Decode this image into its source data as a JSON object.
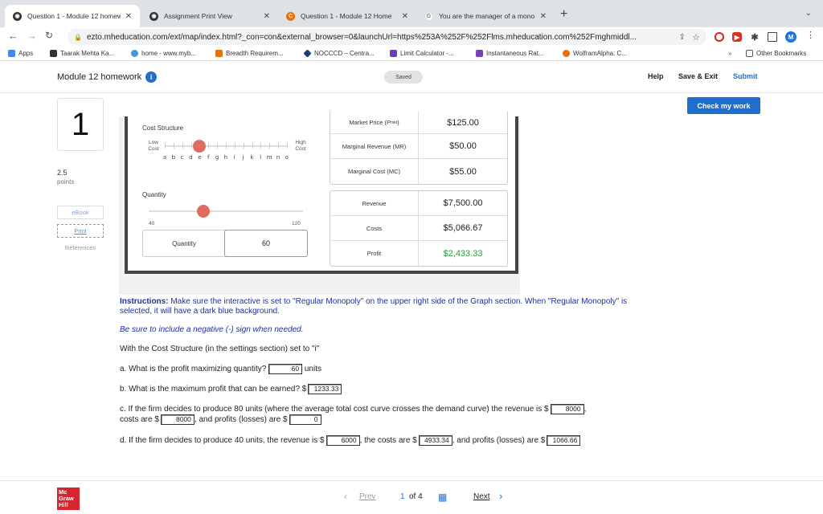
{
  "browser": {
    "tabs": [
      {
        "label": "Question 1 - Module 12 homew",
        "active": true
      },
      {
        "label": "Assignment Print View",
        "active": false
      },
      {
        "label": "Question 1 - Module 12 Home",
        "active": false
      },
      {
        "label": "You are the manager of a mono",
        "active": false
      }
    ],
    "url": "ezto.mheducation.com/ext/map/index.html?_con=con&external_browser=0&launchUrl=https%253A%252F%252Flms.mheducation.com%252Fmghmiddl...",
    "bookmarks": [
      "Apps",
      "Taarak Mehta Ka...",
      "home - www.myb...",
      "Breadth Requirem...",
      "NOCCCD – Centra...",
      "Limit Calculator -...",
      "Instantaneous Rat...",
      "WolframAlpha: C..."
    ],
    "other_bookmarks": "Other Bookmarks",
    "profile_initial": "M"
  },
  "header": {
    "title": "Module 12 homework",
    "info": "i",
    "saved": "Saved",
    "help": "Help",
    "save_exit": "Save & Exit",
    "submit": "Submit",
    "check": "Check my work"
  },
  "sidebar": {
    "question_number": "1",
    "points_value": "2.5",
    "points_label": "points",
    "ebook": "eBook",
    "print": "Print",
    "references": "References"
  },
  "interactive": {
    "cost_structure_title": "Cost Structure",
    "low_cost": "Low Cost",
    "high_cost": "High Cost",
    "letters": [
      "a",
      "b",
      "c",
      "d",
      "e",
      "f",
      "g",
      "h",
      "i",
      "j",
      "k",
      "l",
      "m",
      "n",
      "o"
    ],
    "cost_selected_index": 4,
    "quantity_title": "Quantity",
    "qty_min": "40",
    "qty_max": "120",
    "qty_value": 60,
    "qty_label": "Quantity",
    "qty_display": "60",
    "market_rows": [
      {
        "label": "Market Price (P",
        "sub": "mkt",
        "label_end": ")",
        "value": "$125.00"
      },
      {
        "label": "Marginal Revenue (MR)",
        "value": "$50.00"
      },
      {
        "label": "Marginal Cost (MC)",
        "value": "$55.00"
      }
    ],
    "totals_rows": [
      {
        "label": "Revenue",
        "value": "$7,500.00"
      },
      {
        "label": "Costs",
        "value": "$5,066.67"
      },
      {
        "label": "Profit",
        "value": "$2,433.33"
      }
    ]
  },
  "content": {
    "instr_bold": "Instructions:",
    "instr_text": " Make sure the interactive is set to \"Regular Monopoly\" on the upper right side of the Graph section. When \"Regular Monopoly\" is selected, it will have a dark blue background.",
    "note": "Be sure to include a negative (-) sign when needed.",
    "setting": "With the Cost Structure (in the settings section) set to \"i\"",
    "qa_text": "a. What is the profit maximizing quantity?",
    "qa_answer": "60",
    "qa_units": "units",
    "qb_text": "b. What is the maximum profit that can be earned? $",
    "qb_answer": "1233.33",
    "qc_text1": "c. If the firm decides to produce 80 units (where the average total cost curve crosses the demand curve) the revenue is $",
    "qc_rev": "8000",
    "qc_text2": "costs are $",
    "qc_cost": "8000",
    "qc_text3": ", and profits (losses) are $",
    "qc_profit": "0",
    "qd_text1": "d. If the firm decides to produce 40 units, the revenue is $",
    "qd_rev": "6000",
    "qd_text2": ", the costs are $",
    "qd_cost": "4933.34",
    "qd_text3": ", and profits (losses) are $",
    "qd_profit": "1066.66"
  },
  "footer": {
    "logo_lines": [
      "Mc",
      "Graw",
      "Hill"
    ],
    "prev": "Prev",
    "page_current": "1",
    "page_of": "of 4",
    "next": "Next"
  }
}
